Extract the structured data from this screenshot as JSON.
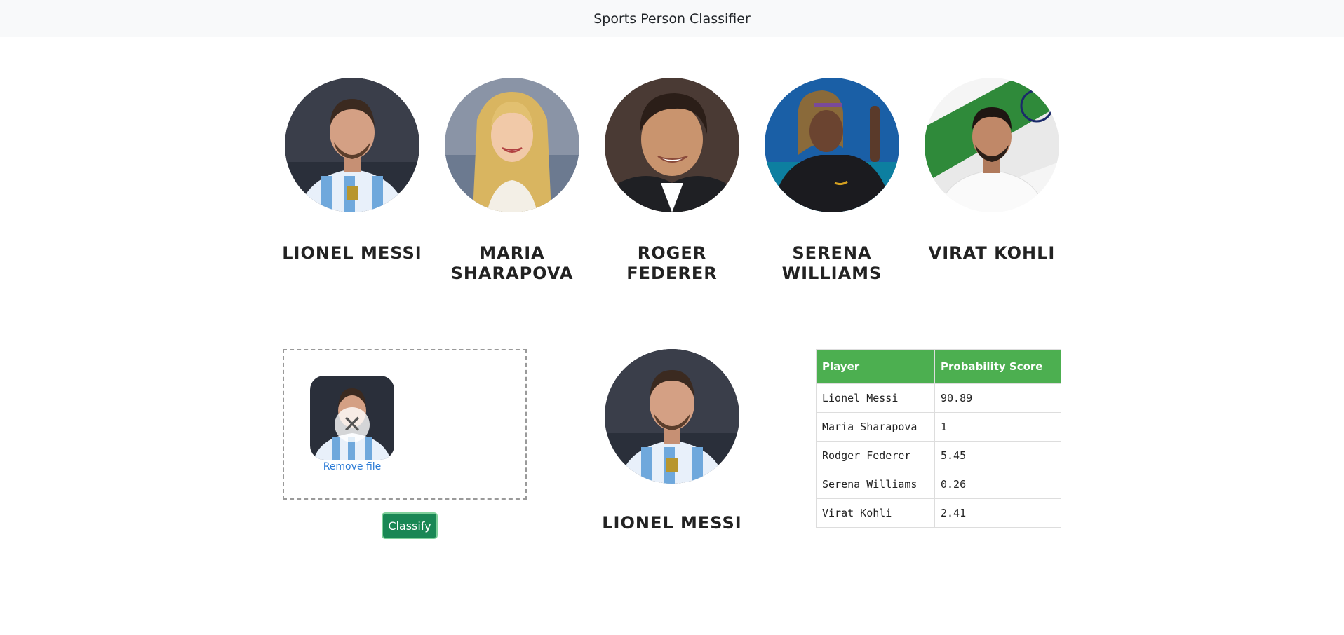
{
  "navbar": {
    "title": "Sports Person Classifier"
  },
  "players": [
    {
      "name": "LIONEL MESSI",
      "icon": "lionel-messi-photo"
    },
    {
      "name": "MARIA SHARAPOVA",
      "icon": "maria-sharapova-photo"
    },
    {
      "name": "ROGER FEDERER",
      "icon": "roger-federer-photo"
    },
    {
      "name": "SERENA WILLIAMS",
      "icon": "serena-williams-photo"
    },
    {
      "name": "VIRAT KOHLI",
      "icon": "virat-kohli-photo"
    }
  ],
  "dropzone": {
    "remove_icon": "✕",
    "remove_label": "Remove file"
  },
  "classify_button": {
    "label": "Classify"
  },
  "result": {
    "name": "LIONEL MESSI"
  },
  "score_table": {
    "headers": [
      "Player",
      "Probability Score"
    ],
    "rows": [
      {
        "player": "Lionel Messi",
        "score": "90.89"
      },
      {
        "player": "Maria Sharapova",
        "score": "1"
      },
      {
        "player": "Rodger Federer",
        "score": "5.45"
      },
      {
        "player": "Serena Williams",
        "score": "0.26"
      },
      {
        "player": "Virat Kohli",
        "score": "2.41"
      }
    ]
  },
  "colors": {
    "table_header": "#4caf50",
    "classify_button": "#198754",
    "navbar_bg": "#f8f9fa"
  }
}
